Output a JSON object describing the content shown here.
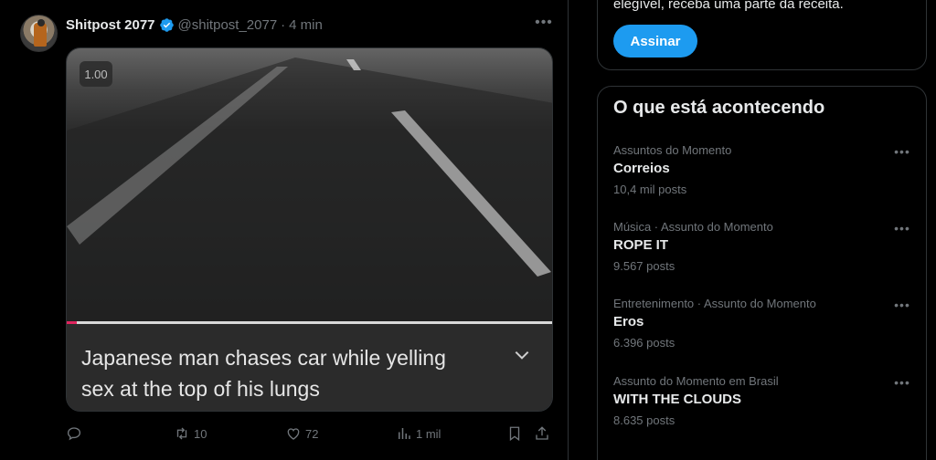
{
  "tweet": {
    "author_name": "Shitpost 2077",
    "handle": "@shitpost_2077",
    "separator": "·",
    "time": "4 min",
    "more_icon": "•••",
    "media": {
      "speed_badge": "1.00",
      "caption": "Japanese man chases car while yelling sex at the top of his lungs",
      "progress_fraction": 0.02
    },
    "actions": {
      "reply_count": "",
      "retweets": "10",
      "likes": "72",
      "views": "1 mil"
    }
  },
  "sidebar": {
    "premium_text": "elegível, receba uma parte da receita.",
    "subscribe_label": "Assinar",
    "trends_title": "O que está acontecendo",
    "trends": [
      {
        "context": "Assuntos do Momento",
        "topic": "Correios",
        "count": "10,4 mil posts"
      },
      {
        "context": "Música · Assunto do Momento",
        "topic": "ROPE IT",
        "count": "9.567 posts"
      },
      {
        "context": "Entretenimento · Assunto do Momento",
        "topic": "Eros",
        "count": "6.396 posts"
      },
      {
        "context": "Assunto do Momento em Brasil",
        "topic": "WITH THE CLOUDS",
        "count": "8.635 posts"
      }
    ],
    "more_icon": "•••"
  },
  "colors": {
    "accent": "#1d9bf0",
    "muted_text": "#71767b",
    "border": "#2f3336",
    "background": "#000000"
  }
}
